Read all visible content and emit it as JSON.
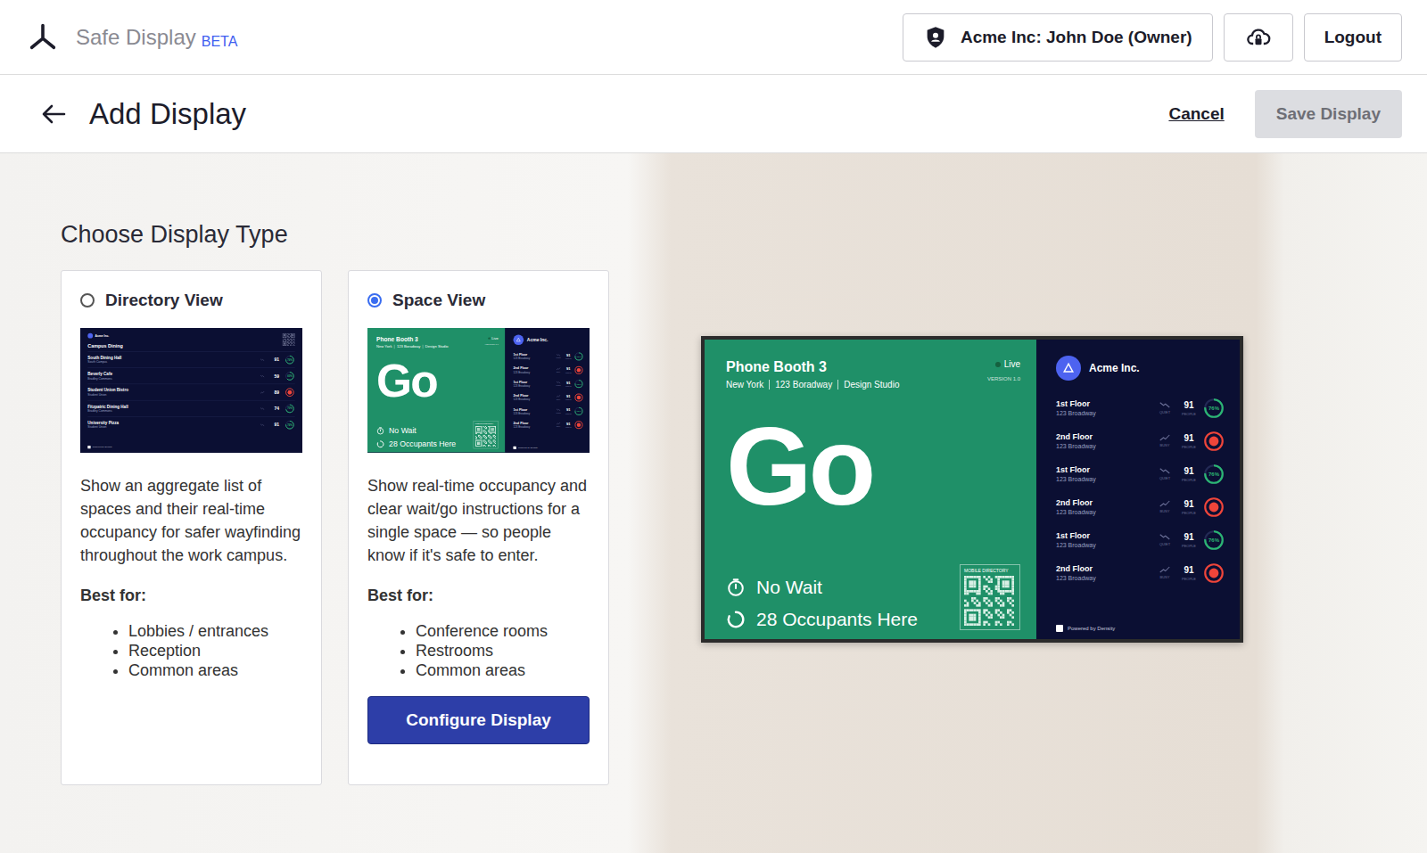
{
  "app": {
    "name": "Safe Display",
    "badge": "BETA"
  },
  "account": {
    "label": "Acme Inc: John Doe (Owner)"
  },
  "logout": "Logout",
  "page": {
    "title": "Add Display",
    "cancel": "Cancel",
    "save": {
      "label": "Save Display",
      "disabled": true
    }
  },
  "section_title": "Choose Display Type",
  "display_types": [
    {
      "kind": "directory",
      "label": "Directory View",
      "selected": false,
      "description": "Show an aggregate list of spaces and their real-time occupancy for safer wayfinding throughout the work campus.",
      "best_for_label": "Best for:",
      "best_for": [
        "Lobbies / entrances",
        "Reception",
        "Common areas"
      ]
    },
    {
      "kind": "space",
      "label": "Space View",
      "selected": true,
      "description": "Show real-time occupancy and clear wait/go instructions for a single space — so people know if it's safe to enter.",
      "best_for_label": "Best for:",
      "best_for": [
        "Conference rooms",
        "Restrooms",
        "Common areas"
      ],
      "action": "Configure Display"
    }
  ],
  "directory_preview": {
    "org": "Acme Inc.",
    "title": "Campus Dining",
    "footer": "Powered by Density",
    "rows": [
      {
        "name": "South Dining Hall",
        "sub": "South Campus",
        "count": "91",
        "trend": "down",
        "kind": "percent",
        "level": 0.76,
        "reading": "76%",
        "color": "#2bb673"
      },
      {
        "name": "Beverly Cafe",
        "sub": "Bradley Commons",
        "count": "59",
        "trend": "down",
        "kind": "percent",
        "level": 0.6,
        "reading": "60%",
        "color": "#2bb673"
      },
      {
        "name": "Student Union Bistro",
        "sub": "Student Union",
        "count": "89",
        "trend": "up",
        "kind": "alert",
        "level": 1,
        "reading": "",
        "color": "#f0453a"
      },
      {
        "name": "Fitzpatric Dining Hall",
        "sub": "Bradley Commons",
        "count": "74",
        "trend": "down",
        "kind": "percent",
        "level": 0.7,
        "reading": "70%",
        "color": "#2bb673"
      },
      {
        "name": "University Pizza",
        "sub": "Student Union",
        "count": "91",
        "trend": "down",
        "kind": "percent",
        "level": 0.76,
        "reading": "76%",
        "color": "#2bb673"
      }
    ]
  },
  "space_preview": {
    "name": "Phone Booth 3",
    "location": [
      "New York",
      "123 Boradway",
      "Design Studio"
    ],
    "status": "Live",
    "version": "VERSION 1.0",
    "verdict": "Go",
    "wait": "No Wait",
    "occupants": "28 Occupants Here",
    "qr_label": "MOBILE DIRECTORY",
    "org": "Acme Inc.",
    "footer": "Powered by Density",
    "floors": [
      {
        "name": "1st Floor",
        "address": "123 Broadway",
        "count": "91",
        "trend": "down",
        "trend_label": "QUIET",
        "unit": "PEOPLE",
        "kind": "percent",
        "level": 0.76,
        "reading": "76%",
        "color": "#2bb673"
      },
      {
        "name": "2nd Floor",
        "address": "123 Broadway",
        "count": "91",
        "trend": "up",
        "trend_label": "BUSY",
        "unit": "PEOPLE",
        "kind": "alert",
        "level": 1,
        "reading": "",
        "color": "#f0453a"
      },
      {
        "name": "1st Floor",
        "address": "123 Broadway",
        "count": "91",
        "trend": "down",
        "trend_label": "QUIET",
        "unit": "PEOPLE",
        "kind": "percent",
        "level": 0.76,
        "reading": "76%",
        "color": "#2bb673"
      },
      {
        "name": "2nd Floor",
        "address": "123 Broadway",
        "count": "91",
        "trend": "up",
        "trend_label": "BUSY",
        "unit": "PEOPLE",
        "kind": "alert",
        "level": 1,
        "reading": "",
        "color": "#f0453a"
      },
      {
        "name": "1st Floor",
        "address": "123 Broadway",
        "count": "91",
        "trend": "down",
        "trend_label": "QUIET",
        "unit": "PEOPLE",
        "kind": "percent",
        "level": 0.76,
        "reading": "76%",
        "color": "#2bb673"
      },
      {
        "name": "2nd Floor",
        "address": "123 Broadway",
        "count": "91",
        "trend": "up",
        "trend_label": "BUSY",
        "unit": "PEOPLE",
        "kind": "alert",
        "level": 1,
        "reading": "",
        "color": "#f0453a"
      }
    ]
  }
}
